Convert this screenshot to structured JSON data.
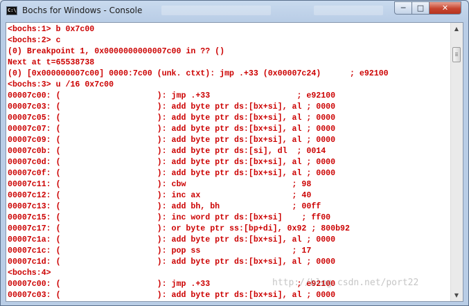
{
  "window": {
    "title": "Bochs for Windows - Console",
    "icon_text": "C:\\"
  },
  "controls": {
    "minimize": "─",
    "maximize": "□",
    "close": "✕"
  },
  "scrollbar": {
    "up": "▲",
    "down": "▼"
  },
  "console": {
    "lines": [
      "<bochs:1> b 0x7c00",
      "<bochs:2> c",
      "(0) Breakpoint 1, 0x0000000000007c00 in ?? ()",
      "Next at t=65538738",
      "(0) [0x000000007c00] 0000:7c00 (unk. ctxt): jmp .+33 (0x00007c24)      ; e92100",
      "<bochs:3> u /16 0x7c00",
      "00007c00: (                    ): jmp .+33                  ; e92100",
      "00007c03: (                    ): add byte ptr ds:[bx+si], al ; 0000",
      "00007c05: (                    ): add byte ptr ds:[bx+si], al ; 0000",
      "00007c07: (                    ): add byte ptr ds:[bx+si], al ; 0000",
      "00007c09: (                    ): add byte ptr ds:[bx+si], al ; 0000",
      "00007c0b: (                    ): add byte ptr ds:[si], dl  ; 0014",
      "00007c0d: (                    ): add byte ptr ds:[bx+si], al ; 0000",
      "00007c0f: (                    ): add byte ptr ds:[bx+si], al ; 0000",
      "00007c11: (                    ): cbw                      ; 98",
      "00007c12: (                    ): inc ax                   ; 40",
      "00007c13: (                    ): add bh, bh               ; 00ff",
      "00007c15: (                    ): inc word ptr ds:[bx+si]    ; ff00",
      "00007c17: (                    ): or byte ptr ss:[bp+di], 0x92 ; 800b92",
      "00007c1a: (                    ): add byte ptr ds:[bx+si], al ; 0000",
      "00007c1c: (                    ): pop ss                   ; 17",
      "00007c1d: (                    ): add byte ptr ds:[bx+si], al ; 0000",
      "<bochs:4>",
      "00007c00: (                    ): jmp .+33                  ; e92100",
      "00007c03: (                    ): add byte ptr ds:[bx+si], al ; 0000"
    ]
  },
  "watermark": "http://blog.csdn.net/port22",
  "colors": {
    "console_text": "#cc0000",
    "console_bg": "#ffffff",
    "titlebar": "#c9daee",
    "close_button": "#c7452f"
  }
}
